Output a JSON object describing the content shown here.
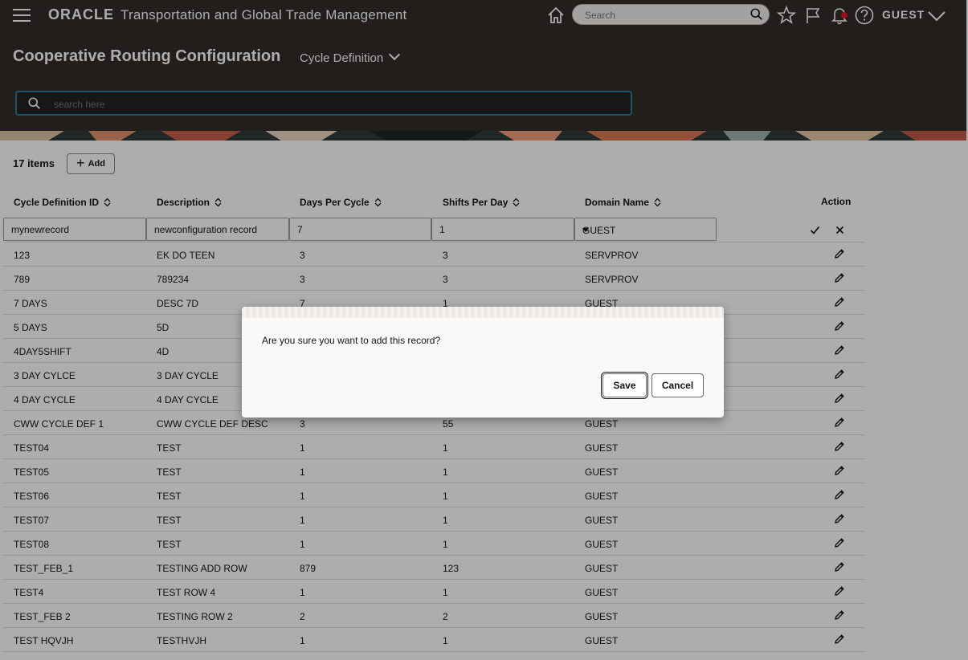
{
  "topbar": {
    "brand": "ORACLE",
    "app_title": "Transportation and Global Trade Management",
    "search_placeholder": "Search",
    "user": "GUEST"
  },
  "header": {
    "page_title": "Cooperative Routing Configuration",
    "subtitle": "Cycle Definition",
    "search_placeholder": "search here"
  },
  "toolbar": {
    "items_count": "17 items",
    "add_label": "Add"
  },
  "table": {
    "columns": [
      "Cycle Definition ID",
      "Description",
      "Days Per Cycle",
      "Shifts Per Day",
      "Domain Name",
      "Action"
    ],
    "new_row": {
      "id": "mynewrecord",
      "description": "newconfiguration record",
      "days": "7",
      "shifts": "1",
      "domain": "GUEST"
    },
    "rows": [
      [
        "123",
        "EK DO TEEN",
        "3",
        "3",
        "SERVPROV"
      ],
      [
        "789",
        "789234",
        "3",
        "3",
        "SERVPROV"
      ],
      [
        "7 DAYS",
        "DESC 7D",
        "7",
        "1",
        "GUEST"
      ],
      [
        "5 DAYS",
        "5D",
        "",
        "",
        ""
      ],
      [
        "4DAY5SHIFT",
        "4D",
        "",
        "",
        ""
      ],
      [
        "3 DAY CYLCE",
        "3 DAY CYCLE",
        "",
        "",
        ""
      ],
      [
        "4 DAY CYCLE",
        "4 DAY CYCLE",
        "",
        "",
        ""
      ],
      [
        "CWW CYCLE DEF 1",
        "CWW CYCLE DEF DESC",
        "3",
        "55",
        "GUEST"
      ],
      [
        "TEST04",
        "TEST",
        "1",
        "1",
        "GUEST"
      ],
      [
        "TEST05",
        "TEST",
        "1",
        "1",
        "GUEST"
      ],
      [
        "TEST06",
        "TEST",
        "1",
        "1",
        "GUEST"
      ],
      [
        "TEST07",
        "TEST",
        "1",
        "1",
        "GUEST"
      ],
      [
        "TEST08",
        "TEST",
        "1",
        "1",
        "GUEST"
      ],
      [
        "TEST_FEB_1",
        "TESTING ADD ROW",
        "879",
        "123",
        "GUEST"
      ],
      [
        "TEST4",
        "TEST ROW 4",
        "1",
        "1",
        "GUEST"
      ],
      [
        "TEST_FEB 2",
        "TESTING ROW 2",
        "2",
        "2",
        "GUEST"
      ],
      [
        "TEST HQVJH",
        "TESTHVJH",
        "1",
        "1",
        "GUEST"
      ]
    ]
  },
  "dialog": {
    "message": "Are you sure you want to add this record?",
    "save_label": "Save",
    "cancel_label": "Cancel"
  },
  "colors": {
    "topbar_bg": "#312d2a",
    "search_focus": "#227e9e",
    "banner": "#e07a4d"
  }
}
